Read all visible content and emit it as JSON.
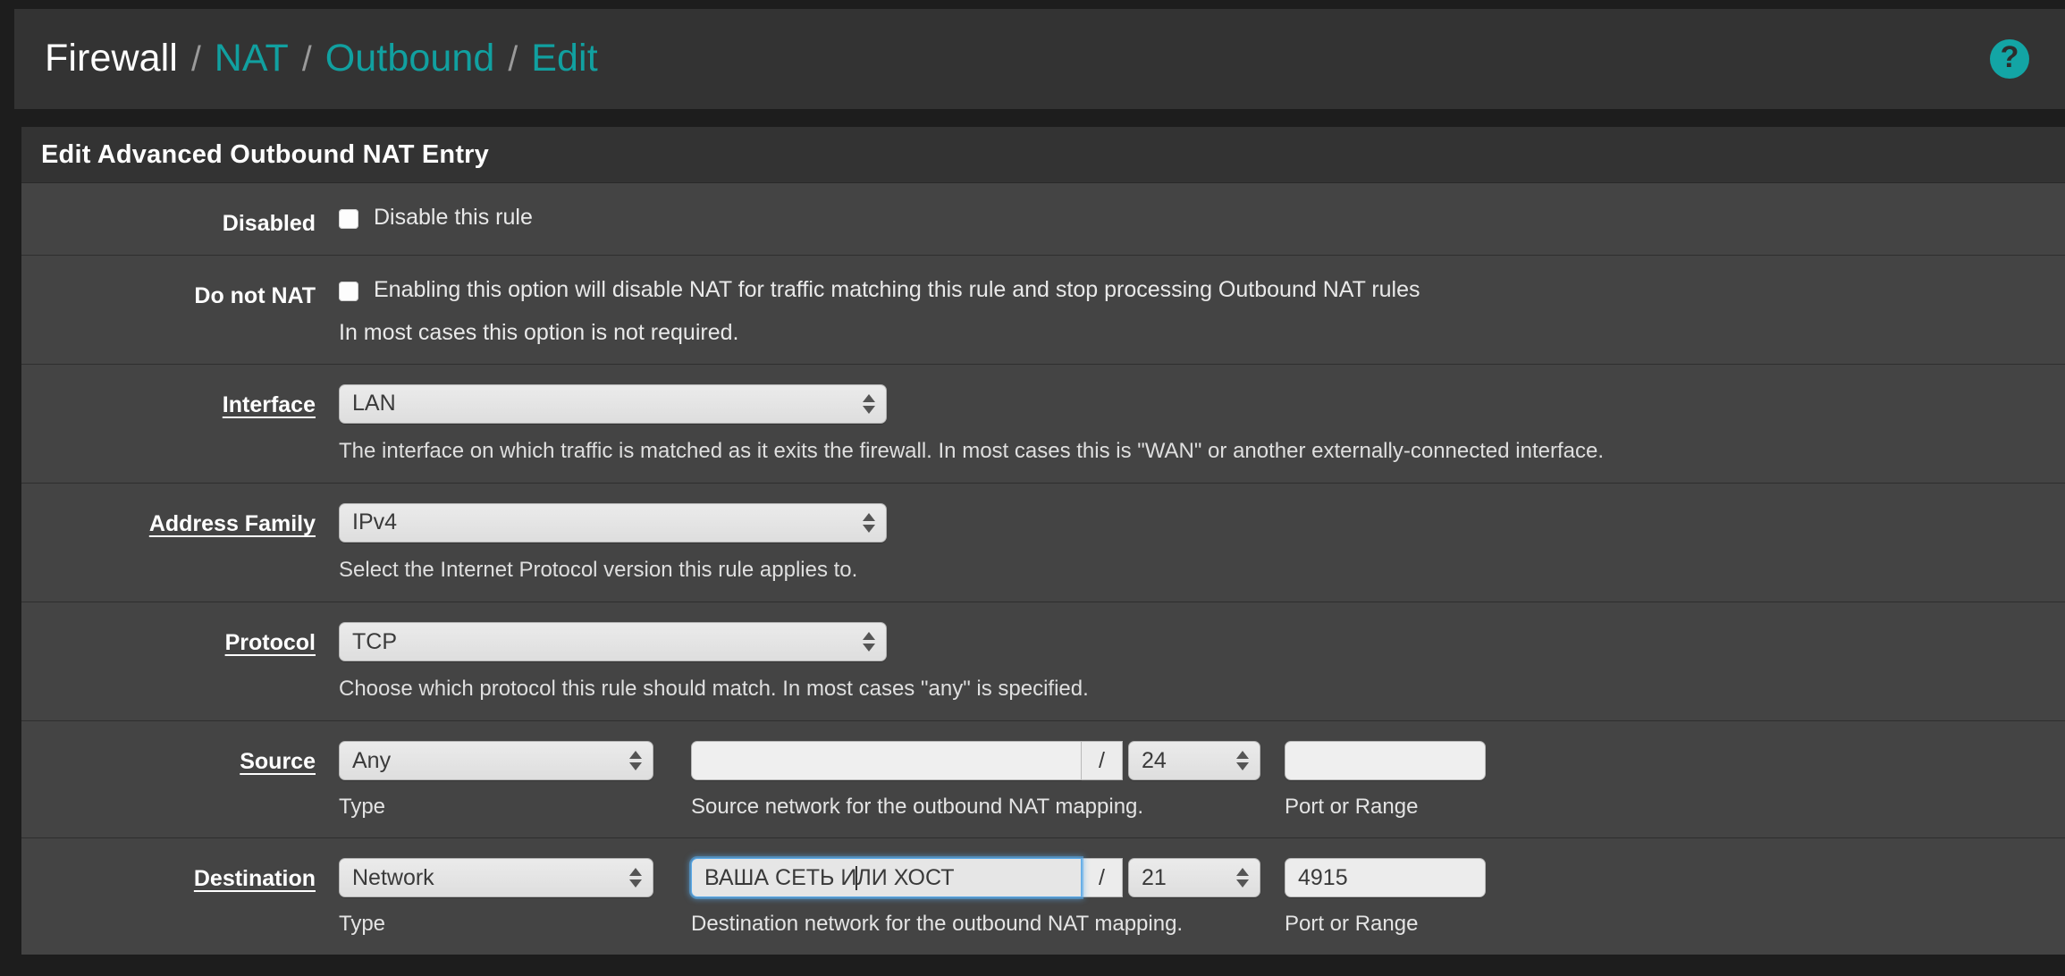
{
  "breadcrumb": {
    "root": "Firewall",
    "sep": "/",
    "items": [
      "NAT",
      "Outbound",
      "Edit"
    ],
    "help_icon": "help-circle-icon",
    "help_glyph": "?",
    "accent_color": "#11a0a0"
  },
  "panel": {
    "title": "Edit Advanced Outbound NAT Entry"
  },
  "rows": {
    "disabled": {
      "label": "Disabled",
      "checkbox_label": "Disable this rule",
      "checked": false
    },
    "do_not_nat": {
      "label": "Do not NAT",
      "checkbox_label": "Enabling this option will disable NAT for traffic matching this rule and stop processing Outbound NAT rules",
      "sub_text": "In most cases this option is not required.",
      "checked": false
    },
    "interface": {
      "label": "Interface",
      "value": "LAN",
      "help": "The interface on which traffic is matched as it exits the firewall. In most cases this is \"WAN\" or another externally-connected interface."
    },
    "address_family": {
      "label": "Address Family",
      "value": "IPv4",
      "help": "Select the Internet Protocol version this rule applies to."
    },
    "protocol": {
      "label": "Protocol",
      "value": "TCP",
      "help": "Choose which protocol this rule should match. In most cases \"any\" is specified."
    },
    "source": {
      "label": "Source",
      "type_value": "Any",
      "type_caption": "Type",
      "network_value": "",
      "network_placeholder": "",
      "slash": "/",
      "mask_value": "24",
      "network_caption": "Source network for the outbound NAT mapping.",
      "port_value": "",
      "port_caption": "Port or Range",
      "focused": false
    },
    "destination": {
      "label": "Destination",
      "type_value": "Network",
      "type_caption": "Type",
      "network_value": "ВАША СЕТЬ ИЛИ ХОСТ",
      "network_value_before_caret": "ВАША СЕТЬ И",
      "network_value_after_caret": "ЛИ ХОСТ",
      "slash": "/",
      "mask_value": "21",
      "network_caption": "Destination network for the outbound NAT mapping.",
      "port_value": "4915",
      "port_caption": "Port or Range",
      "focused": true
    }
  }
}
